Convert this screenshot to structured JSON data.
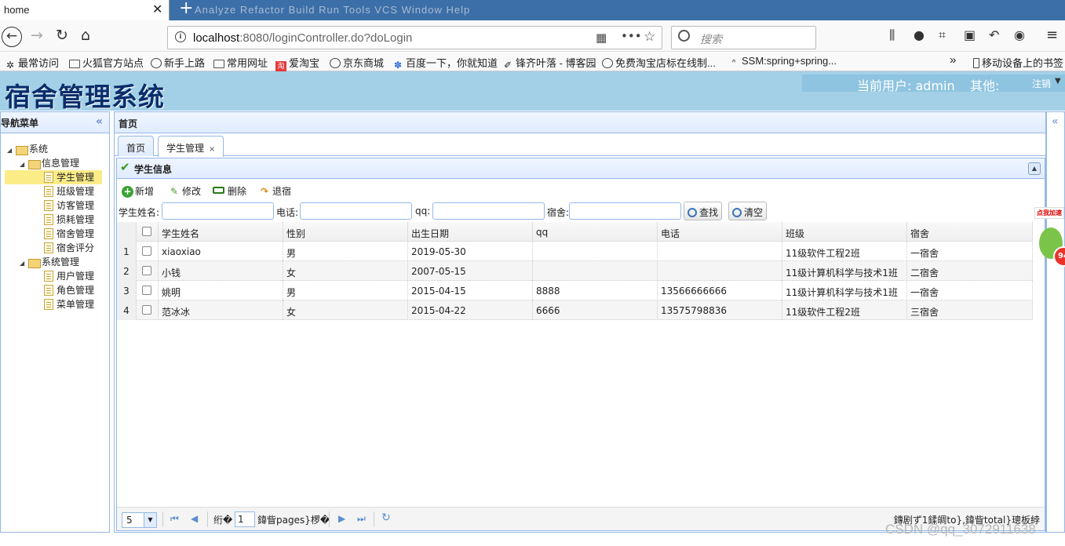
{
  "browser": {
    "tab_title": "home",
    "tab_close": "✕",
    "new_tab": "+",
    "background_text": "Analyze  Refactor  Build  Run  Tools  VCS  Window  Help",
    "url_host": "localhost",
    "url_rest": ":8080/loginController.do?doLogin",
    "search_placeholder": "搜索",
    "bookmarks": [
      {
        "label": "最常访问",
        "icon": "gear-icon"
      },
      {
        "label": "火狐官方站点",
        "icon": "folder-icon"
      },
      {
        "label": "新手上路",
        "icon": "globe-icon"
      },
      {
        "label": "常用网址",
        "icon": "folder-icon"
      },
      {
        "label": "爱淘宝",
        "icon": "taobao-icon"
      },
      {
        "label": "京东商城",
        "icon": "globe-icon"
      },
      {
        "label": "百度一下，你就知道",
        "icon": "baidu-icon"
      },
      {
        "label": "锋齐叶落 - 博客园",
        "icon": "blog-icon"
      },
      {
        "label": "免费淘宝店标在线制...",
        "icon": "globe-icon"
      },
      {
        "label": "SSM:spring+spring...",
        "icon": "csdn-icon"
      },
      {
        "label": "移动设备上的书签",
        "icon": "mobile-icon"
      }
    ],
    "more_bookmarks": "»"
  },
  "header": {
    "app_title": "宿舍管理系统",
    "current_user_label": "当前用户: admin",
    "other_label": "其他:",
    "logout_label": "注销"
  },
  "left_nav": {
    "title": "导航菜单",
    "collapse": "«",
    "tree": [
      {
        "label": "系统",
        "type": "folder"
      },
      {
        "label": "信息管理",
        "type": "folder"
      },
      {
        "label": "学生管理",
        "type": "file"
      },
      {
        "label": "班级管理",
        "type": "file"
      },
      {
        "label": "访客管理",
        "type": "file"
      },
      {
        "label": "损耗管理",
        "type": "file"
      },
      {
        "label": "宿舍管理",
        "type": "file"
      },
      {
        "label": "宿舍评分",
        "type": "file"
      },
      {
        "label": "系统管理",
        "type": "folder"
      },
      {
        "label": "用户管理",
        "type": "file"
      },
      {
        "label": "角色管理",
        "type": "file"
      },
      {
        "label": "菜单管理",
        "type": "file"
      }
    ],
    "selected": "学生管理"
  },
  "main": {
    "panel_title": "首页",
    "tabs": [
      {
        "label": "首页"
      },
      {
        "label": "学生管理",
        "close": "×"
      }
    ],
    "section_title": "学生信息",
    "toolbar": {
      "add": "新增",
      "edit": "修改",
      "delete": "删除",
      "checkout": "退宿"
    },
    "filters": {
      "name_label": "学生姓名:",
      "phone_label": "电话:",
      "qq_label": "qq:",
      "dorm_label": "宿舍:",
      "search_button": "查找",
      "clear_button": "清空"
    },
    "grid": {
      "columns": [
        "学生姓名",
        "性别",
        "出生日期",
        "qq",
        "电话",
        "班级",
        "宿舍"
      ],
      "rows": [
        {
          "n": "1",
          "name": "xiaoxiao",
          "sex": "男",
          "birth": "2019-05-30",
          "qq": "",
          "phone": "",
          "class": "11级软件工程2班",
          "dorm": "一宿舍"
        },
        {
          "n": "2",
          "name": "小钱",
          "sex": "女",
          "birth": "2007-05-15",
          "qq": "",
          "phone": "",
          "class": "11级计算机科学与技术1班",
          "dorm": "二宿舍"
        },
        {
          "n": "3",
          "name": "姚明",
          "sex": "男",
          "birth": "2015-04-15",
          "qq": "8888",
          "phone": "13566666666",
          "class": "11级计算机科学与技术1班",
          "dorm": "一宿舍"
        },
        {
          "n": "4",
          "name": "范冰冰",
          "sex": "女",
          "birth": "2015-04-22",
          "qq": "6666",
          "phone": "13575798836",
          "class": "11级软件工程2班",
          "dorm": "三宿舍"
        }
      ]
    },
    "pager": {
      "page_size": "5",
      "before_page": "绗�",
      "page_number": "1",
      "after_page": "鍏眥pages}椤�",
      "summary": "鏄剧ず1鍒皗to},鍏眥total}璁板綍"
    }
  },
  "ad": {
    "text": "点我加速",
    "number": "94"
  },
  "watermark": "CSDN @qq_3072911638"
}
